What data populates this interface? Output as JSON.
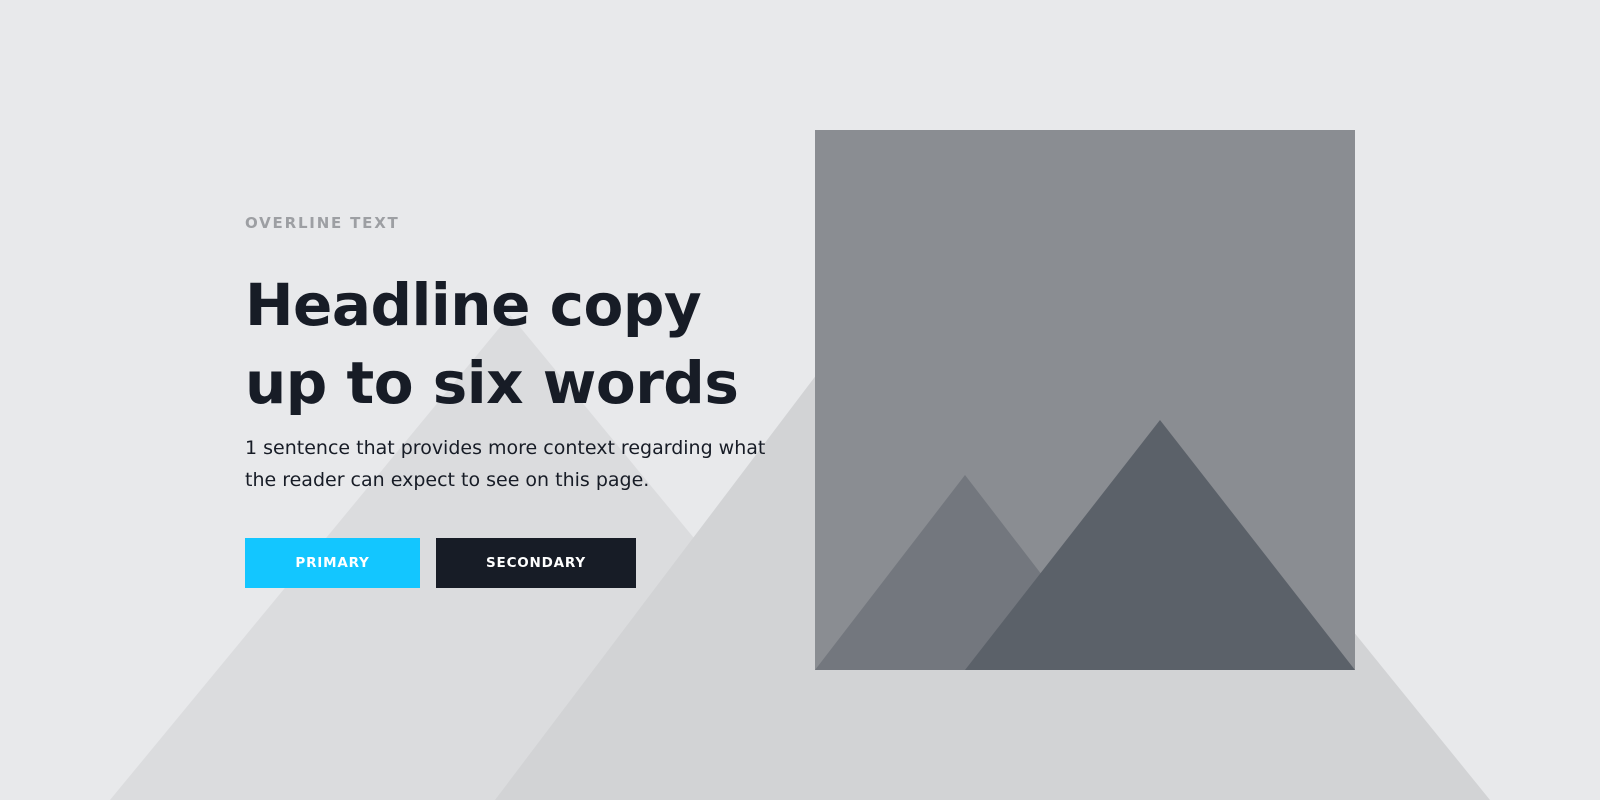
{
  "hero": {
    "overline": "OVERLINE TEXT",
    "headline": "Headline copy up to six words",
    "subcopy": "1 sentence that provides more context regarding what the reader can expect to see on this page.",
    "primary_label": "PRIMARY",
    "secondary_label": "SECONDARY"
  },
  "image": {
    "icon": "image-placeholder-icon"
  },
  "colors": {
    "background": "#e8e9eb",
    "bg_shape_light": "#dbdcde",
    "bg_shape_dark": "#d2d3d5",
    "primary": "#13c6ff",
    "secondary": "#171c26",
    "text": "#171c26",
    "overline": "#9d9fa3",
    "placeholder_bg": "#8a8d92",
    "placeholder_mountain_back": "#73777e",
    "placeholder_mountain_front": "#5b6169"
  }
}
